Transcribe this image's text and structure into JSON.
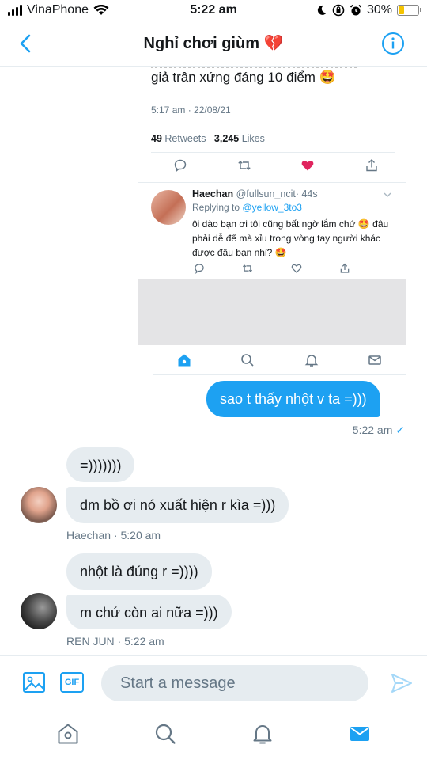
{
  "status_bar": {
    "carrier": "VinaPhone",
    "time": "5:22 am",
    "battery": "30%",
    "battery_level": 0.3
  },
  "header": {
    "title": "Nghỉ chơi giùm",
    "title_emoji": "💔"
  },
  "tweet": {
    "text": "giả trân xứng đáng 10 điểm 🤩",
    "timestamp": "5:17 am · 22/08/21",
    "retweets_count": "49",
    "retweets_label": "Retweets",
    "likes_count": "3,245",
    "likes_label": "Likes",
    "reply": {
      "name": "Haechan",
      "handle": "@fullsun_ncit",
      "age": "· 44s",
      "replying_prefix": "Replying to",
      "replying_handle": "@yellow_3to3",
      "text": "ôi dào bạn ơi tôi cũng bất ngờ lắm chứ 🤩 đâu phải dễ để mà xỉu trong vòng tay người khác được đâu bạn nhỉ? 🤩"
    }
  },
  "messages": {
    "outgoing_1": "sao t thấy nhột v ta =)))",
    "outgoing_1_time": "5:22 am",
    "in_1a": "=)))))))",
    "in_1b": "dm bồ ơi nó xuất hiện r kìa =)))",
    "in_1_meta": "Haechan · 5:20 am",
    "in_2a": "nhột là đúng r =))))",
    "in_2b": "m chứ còn ai nữa =)))",
    "in_2_meta": "REN JUN · 5:22 am"
  },
  "composer": {
    "gif_label": "GIF",
    "placeholder": "Start a message"
  },
  "colors": {
    "accent": "#1da1f2",
    "like_red": "#e0245e",
    "bubble_gray": "#e6ecf0",
    "meta_gray": "#657786"
  }
}
